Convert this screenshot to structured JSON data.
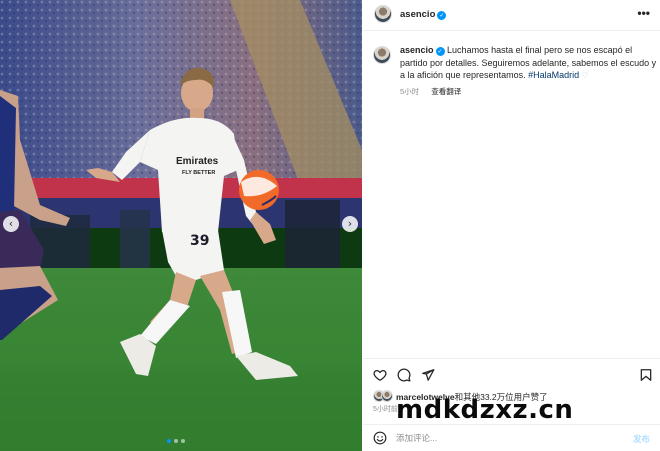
{
  "post": {
    "username": "asencio",
    "verified_icon": "verified-badge-icon",
    "more_label": "•••",
    "caption_text": "Luchamos hasta el final pero se nos escapó el partido por detalles. Seguiremos adelante, sabemos el escudo y a la afición que representamos.",
    "hashtag": "#HalaMadrid",
    "caption_emoji": "♡",
    "caption_time": "5小时",
    "translate_label": "查看翻译",
    "likes_user": "marcelotwelve",
    "likes_suffix": "和其他33.2万位用户赞了",
    "post_time": "5小时前"
  },
  "media": {
    "jersey_sponsor": "Emirates",
    "jersey_sponsor_sub": "FLY BETTER",
    "jersey_number": "39",
    "prev_arrow": "‹",
    "next_arrow": "›",
    "slide_count": 3,
    "active_slide": 1
  },
  "actions": {
    "like_icon": "heart-icon",
    "comment_icon": "comment-icon",
    "share_icon": "paper-plane-icon",
    "save_icon": "bookmark-icon"
  },
  "comment": {
    "placeholder": "添加评论...",
    "emoji_icon": "smiley-icon",
    "post_label": "发布"
  },
  "watermark": {
    "text": "mdkdzxz.cn"
  },
  "colors": {
    "accent_blue": "#0095f6",
    "hashtag_blue": "#00376b",
    "muted_text": "#8e8e8e",
    "post_button_disabled": "#b2dffc"
  }
}
